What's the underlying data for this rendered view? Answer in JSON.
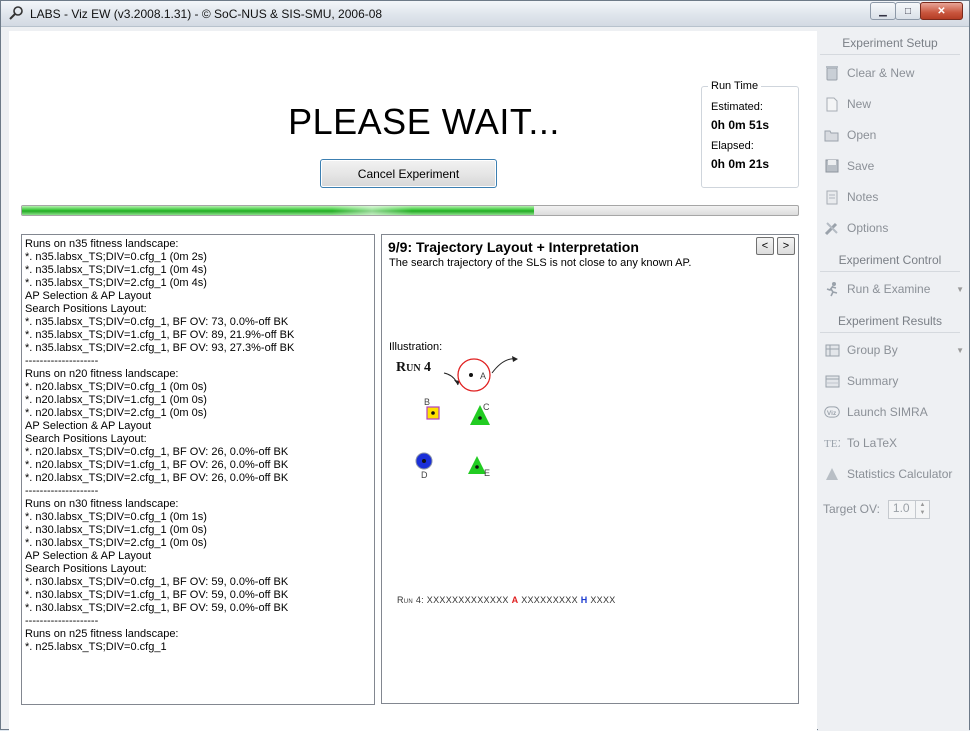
{
  "window": {
    "title": "LABS - Viz EW (v3.2008.1.31) - © SoC-NUS & SIS-SMU, 2006-08"
  },
  "main": {
    "wait_title": "PLEASE WAIT...",
    "cancel_label": "Cancel Experiment",
    "progress_fraction": 0.66,
    "runtime": {
      "legend": "Run Time",
      "estimated_label": "Estimated:",
      "estimated_value": "0h 0m 51s",
      "elapsed_label": "Elapsed:",
      "elapsed_value": "0h 0m 21s"
    }
  },
  "log": [
    "Runs on n35 fitness landscape:",
    "*. n35.labsx_TS;DIV=0.cfg_1 (0m 2s)",
    "*. n35.labsx_TS;DIV=1.cfg_1 (0m 4s)",
    "*. n35.labsx_TS;DIV=2.cfg_1 (0m 4s)",
    "AP Selection & AP Layout",
    "Search Positions Layout:",
    "*. n35.labsx_TS;DIV=0.cfg_1, BF OV: 73, 0.0%-off BK",
    "*. n35.labsx_TS;DIV=1.cfg_1, BF OV: 89, 21.9%-off BK",
    "*. n35.labsx_TS;DIV=2.cfg_1, BF OV: 93, 27.3%-off BK",
    "--------------------",
    "Runs on n20 fitness landscape:",
    "*. n20.labsx_TS;DIV=0.cfg_1 (0m 0s)",
    "*. n20.labsx_TS;DIV=1.cfg_1 (0m 0s)",
    "*. n20.labsx_TS;DIV=2.cfg_1 (0m 0s)",
    "AP Selection & AP Layout",
    "Search Positions Layout:",
    "*. n20.labsx_TS;DIV=0.cfg_1, BF OV: 26, 0.0%-off BK",
    "*. n20.labsx_TS;DIV=1.cfg_1, BF OV: 26, 0.0%-off BK",
    "*. n20.labsx_TS;DIV=2.cfg_1, BF OV: 26, 0.0%-off BK",
    "--------------------",
    "Runs on n30 fitness landscape:",
    "*. n30.labsx_TS;DIV=0.cfg_1 (0m 1s)",
    "*. n30.labsx_TS;DIV=1.cfg_1 (0m 0s)",
    "*. n30.labsx_TS;DIV=2.cfg_1 (0m 0s)",
    "AP Selection & AP Layout",
    "Search Positions Layout:",
    "*. n30.labsx_TS;DIV=0.cfg_1, BF OV: 59, 0.0%-off BK",
    "*. n30.labsx_TS;DIV=1.cfg_1, BF OV: 59, 0.0%-off BK",
    "*. n30.labsx_TS;DIV=2.cfg_1, BF OV: 59, 0.0%-off BK",
    "--------------------",
    "Runs on n25 fitness landscape:",
    "*. n25.labsx_TS;DIV=0.cfg_1"
  ],
  "info": {
    "title": "9/9: Trajectory Layout + Interpretation",
    "subtitle": "The search trajectory of the SLS is not close to any known AP.",
    "prev_label": "<",
    "next_label": ">",
    "illustration_label": "Illustration:",
    "run_label": "Run 4",
    "points": [
      "A",
      "B",
      "C",
      "D",
      "E"
    ],
    "trace_prefix": "Run 4:",
    "trace_part1": "XXXXXXXXXXXXX",
    "trace_mark_a": "A",
    "trace_part2": "XXXXXXXXX",
    "trace_mark_h": "H",
    "trace_part3": "XXXX",
    "colors": {
      "ring_red": "#e02020",
      "square_yellow": "#ffe200",
      "triangle_green": "#22cc22",
      "circle_blue": "#1a2fd8",
      "square_border": "#b040c0"
    }
  },
  "sidebar": {
    "setup_header": "Experiment Setup",
    "setup_items": [
      {
        "label": "Clear & New",
        "icon": "recycle-bin-icon"
      },
      {
        "label": "New",
        "icon": "new-file-icon"
      },
      {
        "label": "Open",
        "icon": "folder-open-icon"
      },
      {
        "label": "Save",
        "icon": "floppy-disk-icon"
      },
      {
        "label": "Notes",
        "icon": "notes-icon"
      },
      {
        "label": "Options",
        "icon": "tools-icon"
      }
    ],
    "control_header": "Experiment Control",
    "control_items": [
      {
        "label": "Run & Examine",
        "icon": "running-man-icon"
      }
    ],
    "results_header": "Experiment Results",
    "results_items": [
      {
        "label": "Group By",
        "icon": "grid-icon"
      },
      {
        "label": "Summary",
        "icon": "table-icon"
      },
      {
        "label": "Launch SIMRA",
        "icon": "viz-logo-icon"
      },
      {
        "label": "To LaTeX",
        "icon": "tex-icon"
      },
      {
        "label": "Statistics Calculator",
        "icon": "triangle-icon"
      }
    ],
    "target_label": "Target OV:",
    "target_value": "1.0"
  }
}
